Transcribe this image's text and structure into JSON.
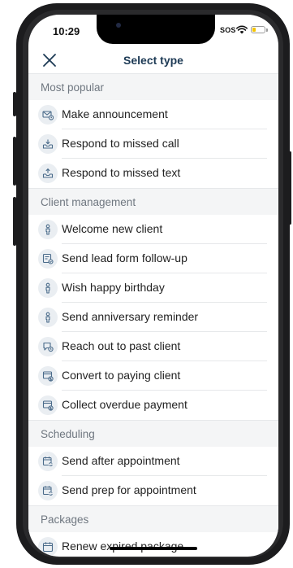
{
  "status_bar": {
    "time": "10:29",
    "sos": "SOS",
    "battery_color": "#f5c400"
  },
  "header": {
    "title": "Select type",
    "close_icon": "close-icon"
  },
  "colors": {
    "title": "#1d3a55",
    "section_bg": "#f4f5f6",
    "icon_bg": "#eaeef2",
    "icon_stroke": "#4a6b8a"
  },
  "sections": [
    {
      "label": "Most popular",
      "items": [
        {
          "label": "Make announcement",
          "icon": "envelope-clock-icon"
        },
        {
          "label": "Respond to missed call",
          "icon": "inbox-download-icon"
        },
        {
          "label": "Respond to missed text",
          "icon": "inbox-upload-icon"
        }
      ]
    },
    {
      "label": "Client management",
      "items": [
        {
          "label": "Welcome new client",
          "icon": "person-icon"
        },
        {
          "label": "Send lead form follow-up",
          "icon": "form-check-icon"
        },
        {
          "label": "Wish happy birthday",
          "icon": "person-icon"
        },
        {
          "label": "Send anniversary reminder",
          "icon": "person-icon"
        },
        {
          "label": "Reach out to past client",
          "icon": "chat-clock-icon"
        },
        {
          "label": "Convert to paying client",
          "icon": "card-dollar-icon"
        },
        {
          "label": "Collect overdue payment",
          "icon": "card-dollar-icon"
        }
      ]
    },
    {
      "label": "Scheduling",
      "items": [
        {
          "label": "Send after appointment",
          "icon": "calendar-refresh-icon"
        },
        {
          "label": "Send prep for appointment",
          "icon": "calendar-refresh-icon"
        }
      ]
    },
    {
      "label": "Packages",
      "items": [
        {
          "label": "Renew expired package",
          "icon": "calendar-icon"
        }
      ]
    }
  ]
}
